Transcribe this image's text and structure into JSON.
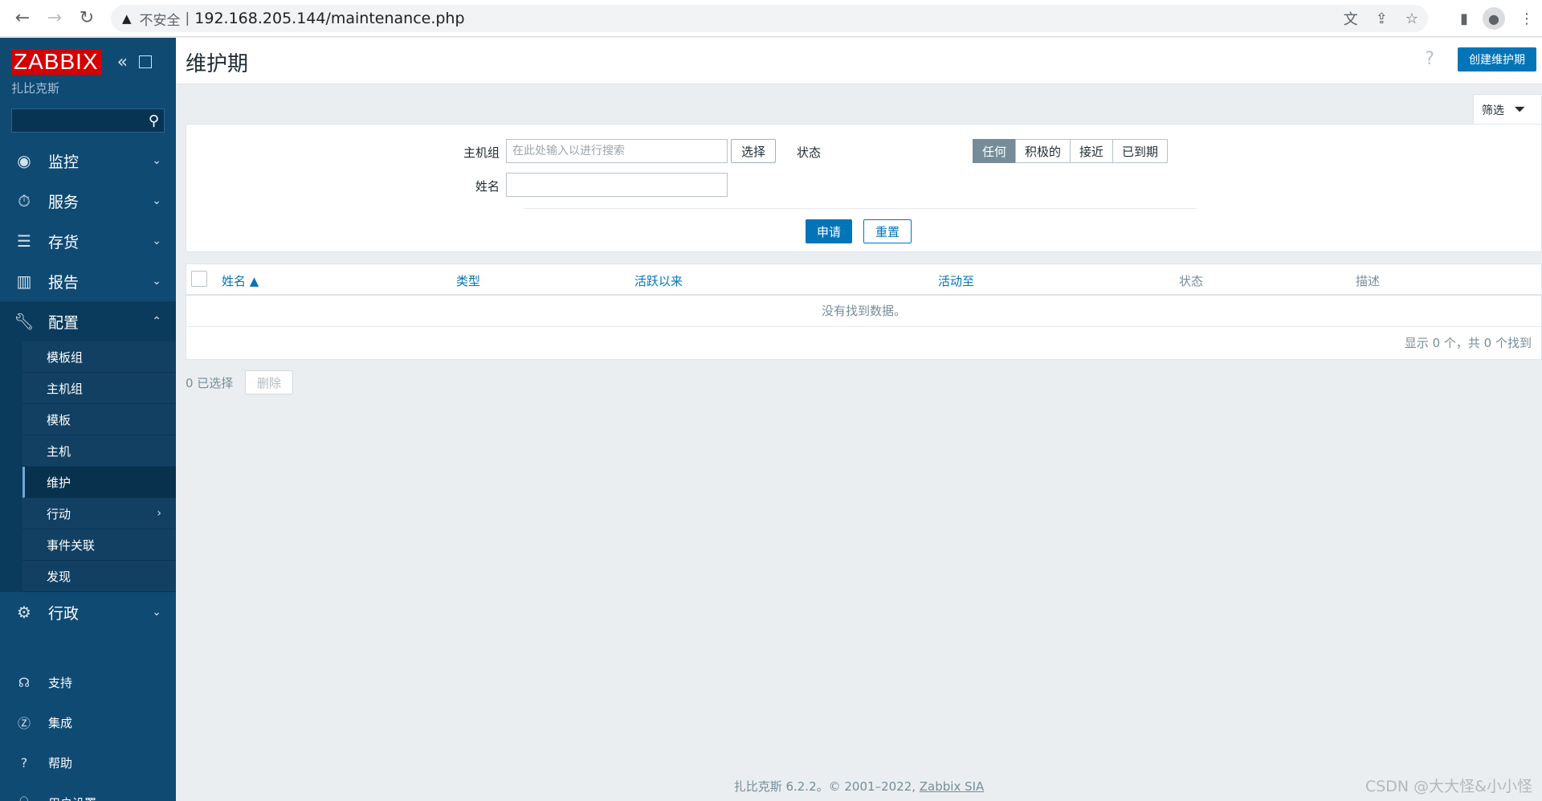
{
  "browser": {
    "security_label": "不安全",
    "separator": "|",
    "url": "192.168.205.144/maintenance.php"
  },
  "sidebar": {
    "logo": "ZABBIX",
    "subtitle": "扎比克斯",
    "search_placeholder": "",
    "menu": [
      {
        "label": "监控",
        "icon": "eye-icon"
      },
      {
        "label": "服务",
        "icon": "stopwatch-icon"
      },
      {
        "label": "存货",
        "icon": "list-icon"
      },
      {
        "label": "报告",
        "icon": "bar-chart-icon"
      },
      {
        "label": "配置",
        "icon": "wrench-icon"
      }
    ],
    "config_submenu": [
      "模板组",
      "主机组",
      "模板",
      "主机",
      "维护",
      "行动",
      "事件关联",
      "发现"
    ],
    "admin": {
      "label": "行政",
      "icon": "gear-icon"
    },
    "bottom": [
      {
        "label": "支持",
        "icon": "headset-icon"
      },
      {
        "label": "集成",
        "icon": "z-icon"
      },
      {
        "label": "帮助",
        "icon": "question-icon"
      },
      {
        "label": "用户设置",
        "icon": "user-icon"
      }
    ]
  },
  "header": {
    "title": "维护期",
    "help": "?",
    "create_button": "创建维护期"
  },
  "filter": {
    "tab_label": "筛选",
    "host_group_label": "主机组",
    "host_group_placeholder": "在此处输入以进行搜索",
    "select_button": "选择",
    "name_label": "姓名",
    "name_value": "",
    "status_label": "状态",
    "status_options": [
      "任何",
      "积极的",
      "接近",
      "已到期"
    ],
    "status_selected": "任何",
    "apply_button": "申请",
    "reset_button": "重置"
  },
  "table": {
    "columns": [
      "姓名 ▲",
      "类型",
      "活跃以来",
      "活动至",
      "状态",
      "描述"
    ],
    "empty_message": "没有找到数据。",
    "footer": "显示 0 个，共 0 个找到"
  },
  "actions": {
    "selected_count": "0 已选择",
    "delete_button": "删除"
  },
  "footer": {
    "text": "扎比克斯 6.2.2。© 2001–2022, ",
    "link": "Zabbix SIA"
  },
  "watermark": "CSDN @大大怪&小小怪",
  "colors": {
    "sidebar": "#0f4a73",
    "primary": "#0275b8",
    "logo": "#d40000"
  }
}
